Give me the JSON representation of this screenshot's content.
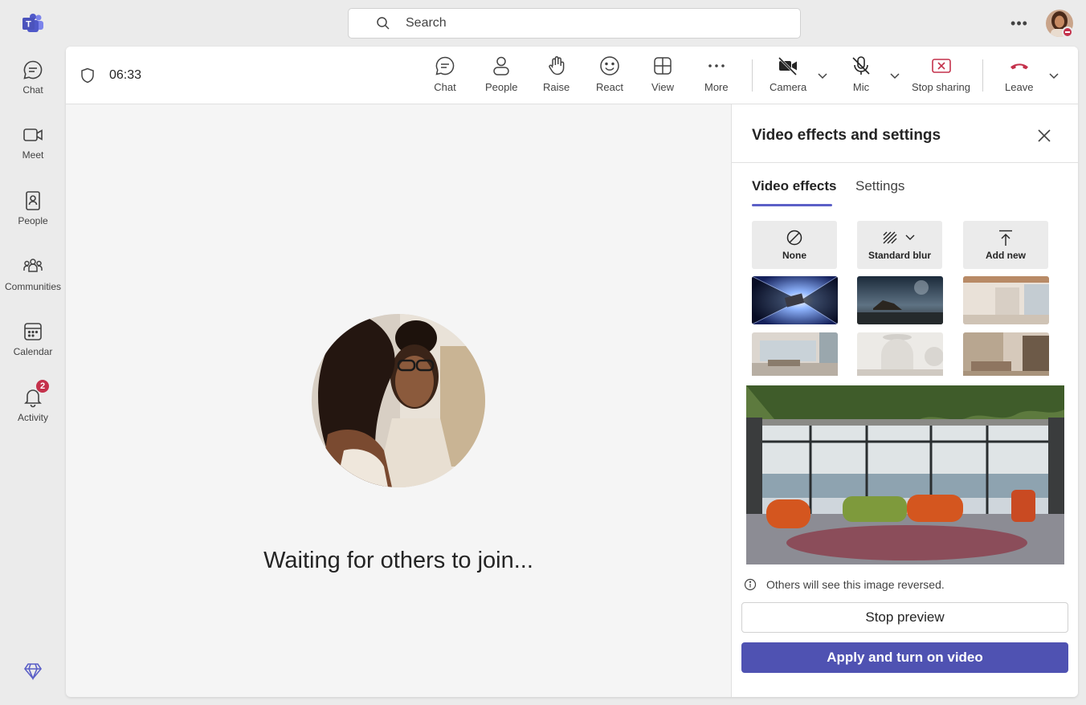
{
  "rail": {
    "items": [
      {
        "label": "Chat"
      },
      {
        "label": "Meet"
      },
      {
        "label": "People"
      },
      {
        "label": "Communities"
      },
      {
        "label": "Calendar"
      },
      {
        "label": "Activity",
        "badge": "2"
      }
    ]
  },
  "search": {
    "placeholder": "Search"
  },
  "meeting": {
    "timer": "06:33",
    "toolbar": {
      "chat": "Chat",
      "people": "People",
      "raise": "Raise",
      "react": "React",
      "view": "View",
      "more": "More",
      "camera": "Camera",
      "mic": "Mic",
      "stop_sharing": "Stop sharing",
      "leave": "Leave"
    },
    "waiting_text": "Waiting for others to join..."
  },
  "panel": {
    "title": "Video effects and settings",
    "tabs": [
      "Video effects",
      "Settings"
    ],
    "effects": {
      "none": "None",
      "blur": "Standard blur",
      "add_new": "Add new"
    },
    "info_text": "Others will see this image reversed.",
    "stop_preview": "Stop preview",
    "apply": "Apply and turn on video"
  },
  "colors": {
    "accent": "#5b5fc7",
    "primary_button": "#4f52b2",
    "leave_red": "#c4314b",
    "badge_red": "#c4314b"
  }
}
